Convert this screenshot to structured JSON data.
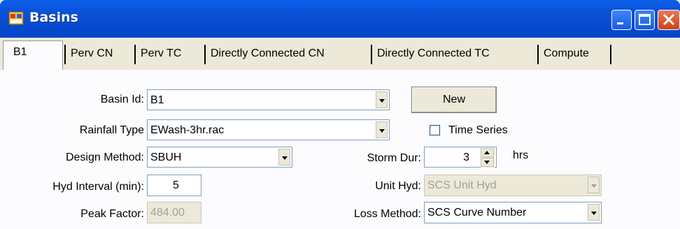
{
  "window": {
    "title": "Basins"
  },
  "tabs": [
    {
      "label": "B1",
      "active": true
    },
    {
      "label": "Perv CN"
    },
    {
      "label": "Perv TC"
    },
    {
      "label": "Directly Connected CN"
    },
    {
      "label": "Directly Connected TC"
    },
    {
      "label": "Compute"
    }
  ],
  "form": {
    "basin_id_label": "Basin Id:",
    "basin_id_value": "B1",
    "new_button": "New",
    "rainfall_type_label": "Rainfall Type",
    "rainfall_type_value": "EWash-3hr.rac",
    "time_series_label": "Time Series",
    "design_method_label": "Design Method:",
    "design_method_value": "SBUH",
    "storm_dur_label": "Storm Dur:",
    "storm_dur_value": "3",
    "storm_dur_unit": "hrs",
    "hyd_interval_label": "Hyd Interval (min):",
    "hyd_interval_value": "5",
    "unit_hyd_label": "Unit Hyd:",
    "unit_hyd_value": "SCS Unit Hyd",
    "peak_factor_label": "Peak Factor:",
    "peak_factor_value": "484.00",
    "loss_method_label": "Loss Method:",
    "loss_method_value": "SCS Curve Number"
  },
  "colors": {
    "title_bar": "#0a4fd6",
    "panel": "#fcfcfe",
    "window_bg": "#ece9d8"
  }
}
